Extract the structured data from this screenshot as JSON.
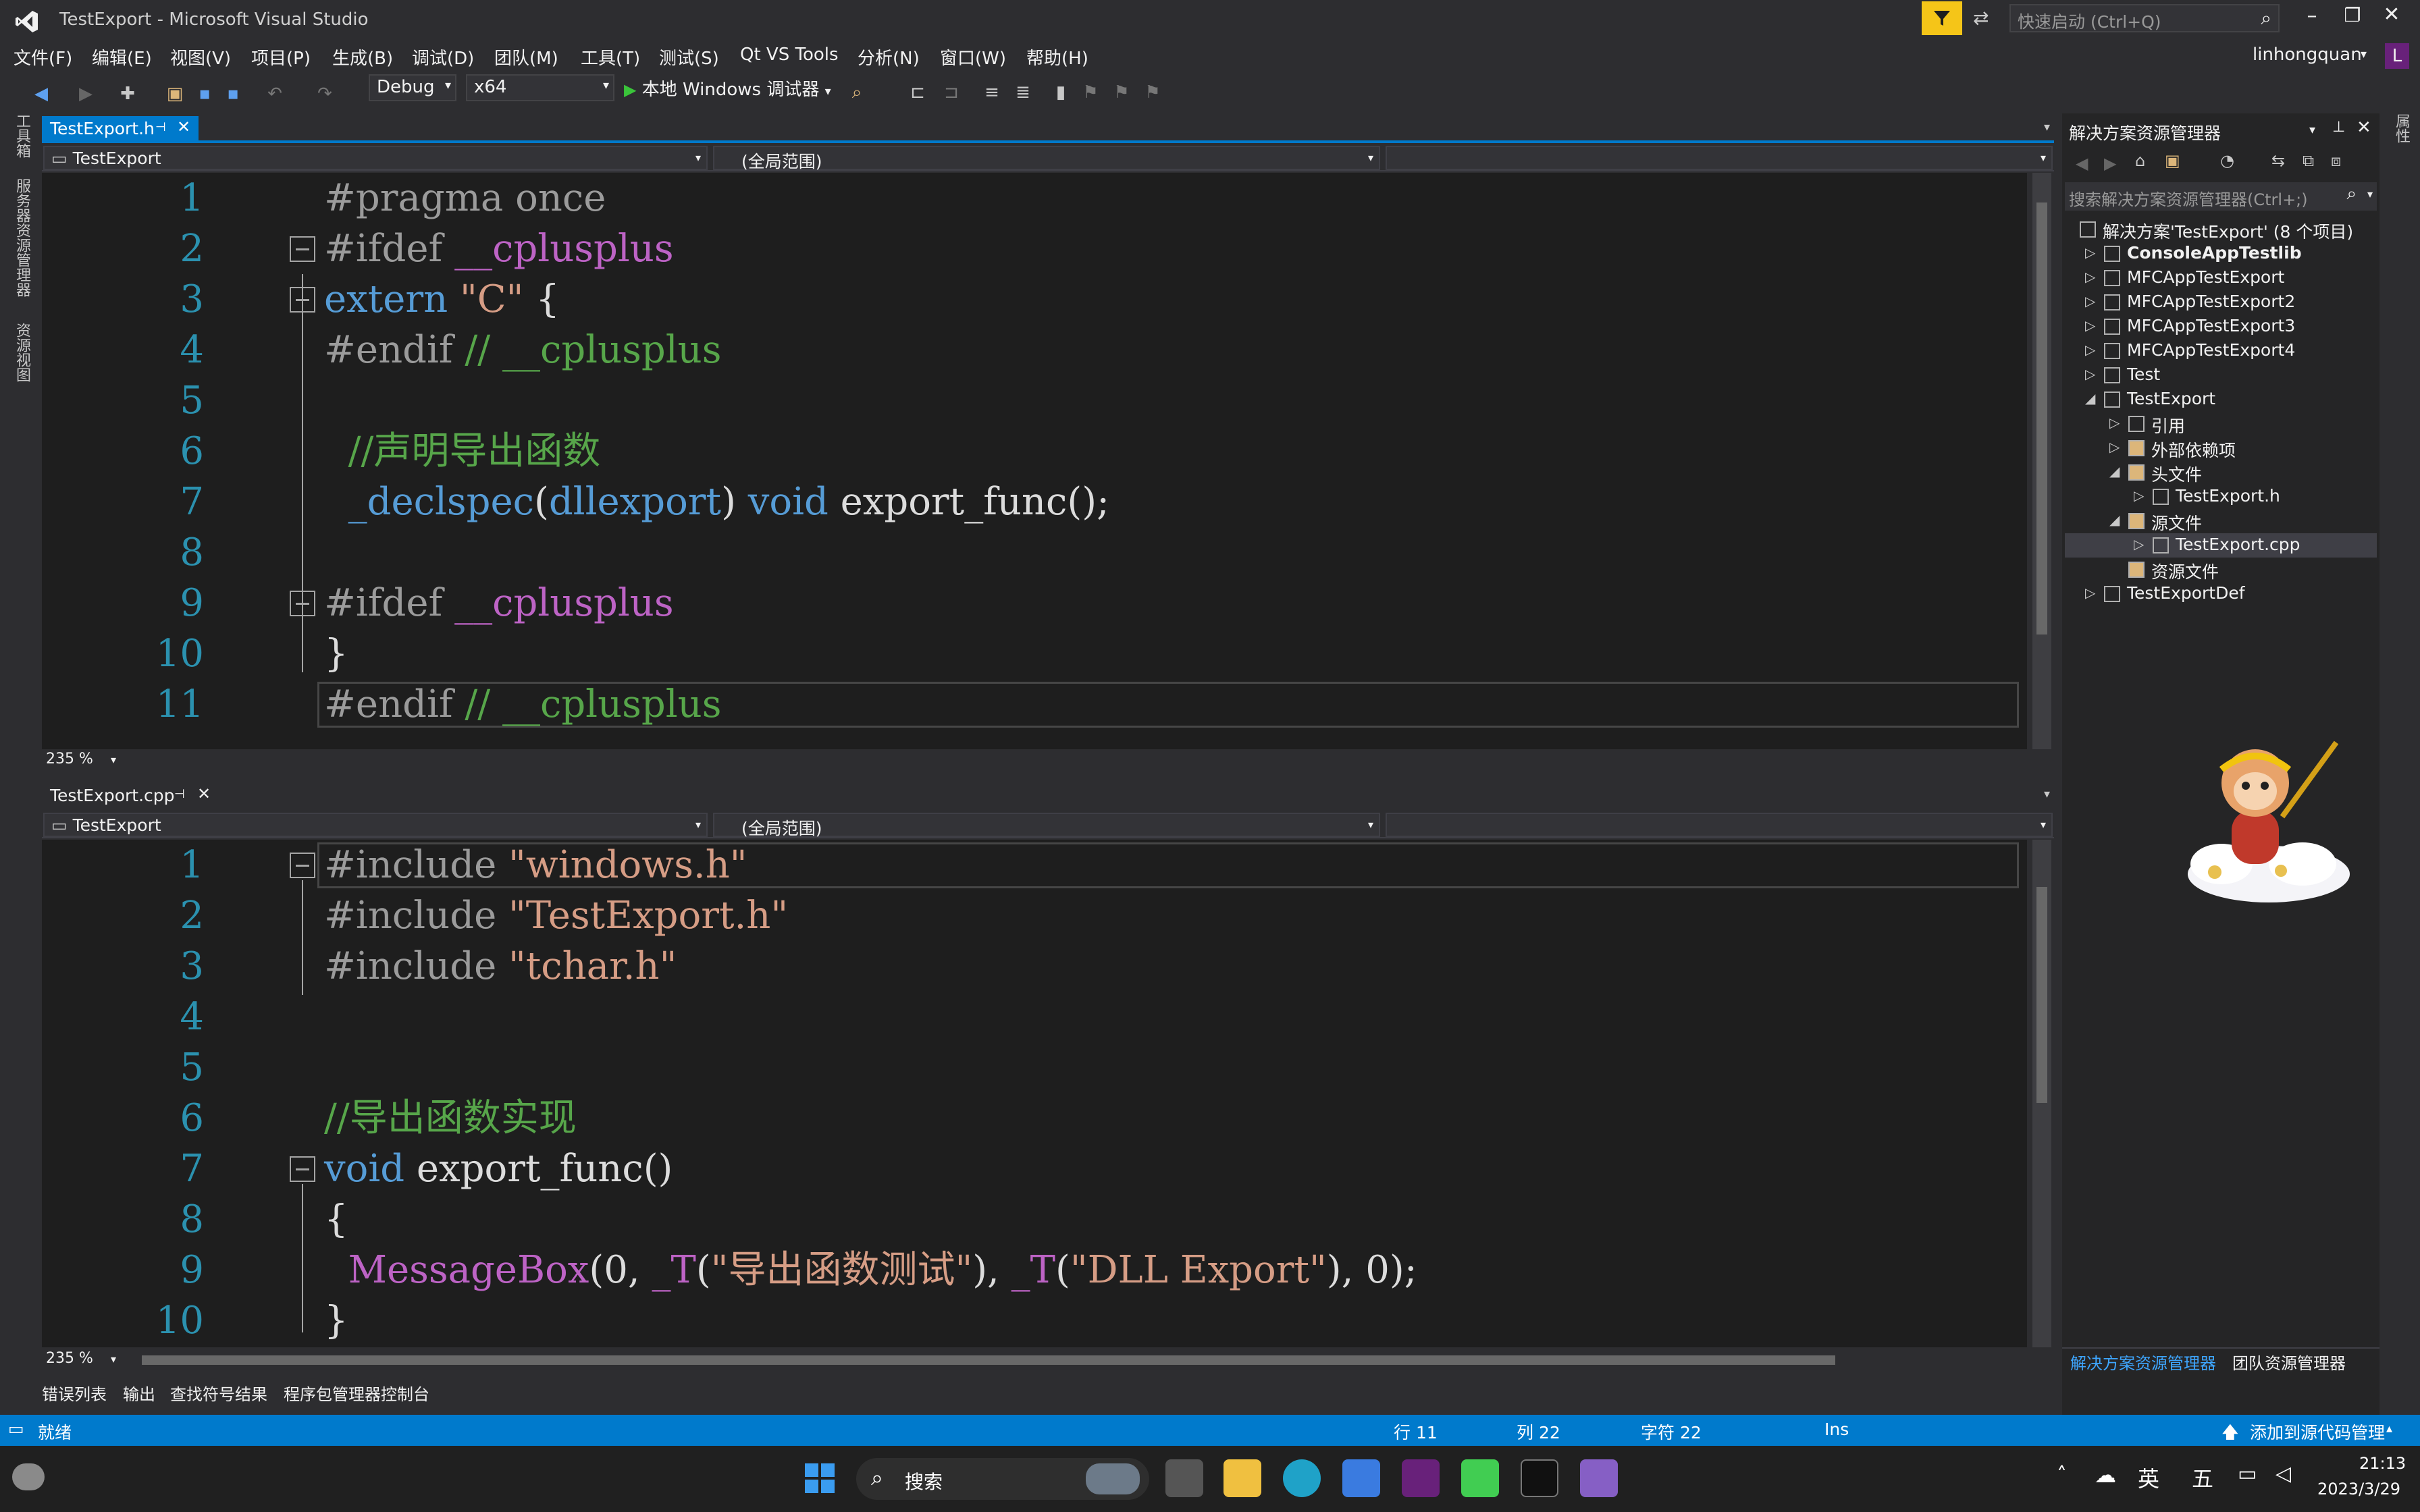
{
  "window": {
    "title": "TestExport - Microsoft Visual Studio"
  },
  "quick_launch": {
    "placeholder": "快速启动 (Ctrl+Q)"
  },
  "user": {
    "name": "linhongquan",
    "initial": "L"
  },
  "menu": [
    "文件(F)",
    "编辑(E)",
    "视图(V)",
    "项目(P)",
    "生成(B)",
    "调试(D)",
    "团队(M)",
    "工具(T)",
    "测试(S)",
    "Qt VS Tools",
    "分析(N)",
    "窗口(W)",
    "帮助(H)"
  ],
  "toolbar": {
    "config": "Debug",
    "platform": "x64",
    "run_label": "本地 Windows 调试器"
  },
  "left_strip": [
    "工具箱",
    "服务器资源管理器",
    "资源视图"
  ],
  "right_strip": "属性",
  "top_editor": {
    "tab": "TestExport.h",
    "nav_left": "TestExport",
    "nav_mid": "(全局范围)",
    "zoom": "235 %",
    "lines": [
      {
        "n": "1",
        "parts": [
          [
            "pp",
            "#pragma once"
          ]
        ]
      },
      {
        "n": "2",
        "parts": [
          [
            "pp",
            "#ifdef "
          ],
          [
            "mac",
            "__cplusplus"
          ]
        ]
      },
      {
        "n": "3",
        "parts": [
          [
            "kw",
            "extern "
          ],
          [
            "str",
            "\"C\""
          ],
          [
            "tx",
            " {"
          ]
        ]
      },
      {
        "n": "4",
        "parts": [
          [
            "pp",
            "#endif "
          ],
          [
            "cm",
            "// __cplusplus"
          ]
        ]
      },
      {
        "n": "5",
        "parts": []
      },
      {
        "n": "6",
        "parts": [
          [
            "tx",
            "  "
          ],
          [
            "cm",
            "//声明导出函数"
          ]
        ]
      },
      {
        "n": "7",
        "parts": [
          [
            "tx",
            "  "
          ],
          [
            "kw",
            "_declspec"
          ],
          [
            "tx",
            "("
          ],
          [
            "kw",
            "dllexport"
          ],
          [
            "tx",
            ") "
          ],
          [
            "kw",
            "void"
          ],
          [
            "fn",
            " export_func();"
          ]
        ]
      },
      {
        "n": "8",
        "parts": []
      },
      {
        "n": "9",
        "parts": [
          [
            "pp",
            "#ifdef "
          ],
          [
            "mac",
            "__cplusplus"
          ]
        ]
      },
      {
        "n": "10",
        "parts": [
          [
            "tx",
            "}"
          ]
        ]
      },
      {
        "n": "11",
        "parts": [
          [
            "pp",
            "#endif "
          ],
          [
            "cm",
            "// __cplusplus"
          ]
        ]
      }
    ]
  },
  "bottom_editor": {
    "tab": "TestExport.cpp",
    "nav_left": "TestExport",
    "nav_mid": "(全局范围)",
    "zoom": "235 %",
    "lines": [
      {
        "n": "1",
        "parts": [
          [
            "pp",
            "#include "
          ],
          [
            "str",
            "\"windows.h\""
          ]
        ]
      },
      {
        "n": "2",
        "parts": [
          [
            "pp",
            "#include "
          ],
          [
            "str",
            "\"TestExport.h\""
          ]
        ]
      },
      {
        "n": "3",
        "parts": [
          [
            "pp",
            "#include "
          ],
          [
            "str",
            "\"tchar.h\""
          ]
        ]
      },
      {
        "n": "4",
        "parts": []
      },
      {
        "n": "5",
        "parts": []
      },
      {
        "n": "6",
        "parts": [
          [
            "cm",
            "//导出函数实现"
          ]
        ]
      },
      {
        "n": "7",
        "parts": [
          [
            "kw",
            "void"
          ],
          [
            "fn",
            " export_func()"
          ]
        ]
      },
      {
        "n": "8",
        "parts": [
          [
            "tx",
            "{"
          ]
        ]
      },
      {
        "n": "9",
        "parts": [
          [
            "tx",
            "  "
          ],
          [
            "mac",
            "MessageBox"
          ],
          [
            "tx",
            "(0, "
          ],
          [
            "mac",
            "_T"
          ],
          [
            "tx",
            "("
          ],
          [
            "str",
            "\"导出函数测试\""
          ],
          [
            "tx",
            "), "
          ],
          [
            "mac",
            "_T"
          ],
          [
            "tx",
            "("
          ],
          [
            "str",
            "\"DLL Export\""
          ],
          [
            "tx",
            "), 0);"
          ]
        ]
      },
      {
        "n": "10",
        "parts": [
          [
            "tx",
            "}"
          ]
        ]
      }
    ]
  },
  "solution_explorer": {
    "title": "解决方案资源管理器",
    "search_placeholder": "搜索解决方案资源管理器(Ctrl+;)",
    "items": [
      {
        "label": "解决方案'TestExport' (8 个项目)",
        "indent": 0,
        "arrow": "",
        "bold": false
      },
      {
        "label": "ConsoleAppTestlib",
        "indent": 1,
        "arrow": "▷",
        "bold": true
      },
      {
        "label": "MFCAppTestExport",
        "indent": 1,
        "arrow": "▷",
        "bold": false
      },
      {
        "label": "MFCAppTestExport2",
        "indent": 1,
        "arrow": "▷",
        "bold": false
      },
      {
        "label": "MFCAppTestExport3",
        "indent": 1,
        "arrow": "▷",
        "bold": false
      },
      {
        "label": "MFCAppTestExport4",
        "indent": 1,
        "arrow": "▷",
        "bold": false
      },
      {
        "label": "Test",
        "indent": 1,
        "arrow": "▷",
        "bold": false
      },
      {
        "label": "TestExport",
        "indent": 1,
        "arrow": "◢",
        "bold": false
      },
      {
        "label": "引用",
        "indent": 2,
        "arrow": "▷",
        "bold": false
      },
      {
        "label": "外部依赖项",
        "indent": 2,
        "arrow": "▷",
        "bold": false
      },
      {
        "label": "头文件",
        "indent": 2,
        "arrow": "◢",
        "bold": false
      },
      {
        "label": "TestExport.h",
        "indent": 3,
        "arrow": "▷",
        "bold": false
      },
      {
        "label": "源文件",
        "indent": 2,
        "arrow": "◢",
        "bold": false
      },
      {
        "label": "TestExport.cpp",
        "indent": 3,
        "arrow": "▷",
        "bold": false
      },
      {
        "label": "资源文件",
        "indent": 2,
        "arrow": "",
        "bold": false
      },
      {
        "label": "TestExportDef",
        "indent": 1,
        "arrow": "▷",
        "bold": false
      }
    ],
    "bottom_tabs": [
      "解决方案资源管理器",
      "团队资源管理器"
    ]
  },
  "bottom_tabs": [
    "错误列表",
    "输出",
    "查找符号结果",
    "程序包管理器控制台"
  ],
  "status": {
    "ready": "就绪",
    "row": "行 11",
    "col": "列 22",
    "char": "字符 22",
    "ins": "Ins",
    "source_control": "添加到源代码管理"
  },
  "taskbar": {
    "search": "搜索",
    "ime1": "英",
    "ime2": "五",
    "time": "21:13",
    "date": "2023/3/29"
  }
}
